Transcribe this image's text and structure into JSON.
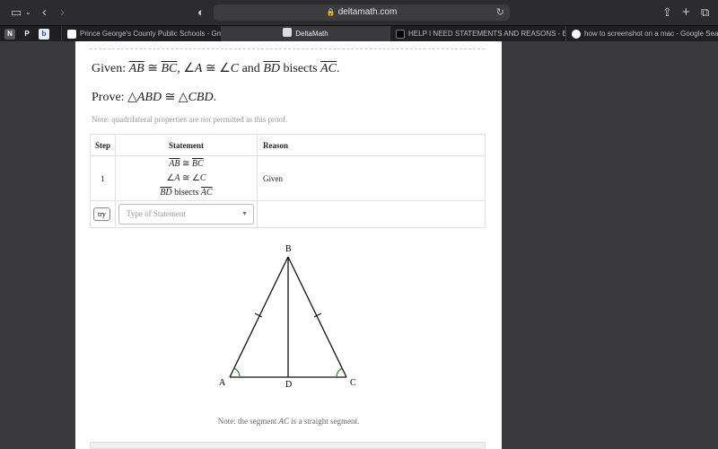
{
  "browser": {
    "url": "deltamath.com",
    "pinned": [
      "N",
      "P",
      "b"
    ],
    "tabs": [
      {
        "label": "Prince George's County Public Schools - Gmail Lo..."
      },
      {
        "label": "DeltaMath"
      },
      {
        "label": "HELP I NEED STATEMENTS AND REASONS - Brai..."
      },
      {
        "label": "how to screenshot on a mac - Google Search"
      }
    ]
  },
  "problem": {
    "given_label": "Given:",
    "ab": "AB",
    "bc": "BC",
    "angle_a": "A",
    "angle_c": "C",
    "and": "and",
    "bd": "BD",
    "bisects": "bisects",
    "ac": "AC",
    "prove_label": "Prove:",
    "tri1": "ABD",
    "tri2": "CBD",
    "note_pre": "Note: quadrilateral properties are ",
    "note_not": "not",
    "note_post": " permitted in this proof."
  },
  "table": {
    "headers": {
      "step": "Step",
      "statement": "Statement",
      "reason": "Reason"
    },
    "row1": {
      "step": "1",
      "reason": "Given"
    },
    "try_label": "try",
    "placeholder": "Type of Statement"
  },
  "diagram": {
    "labels": {
      "a": "A",
      "b": "B",
      "c": "C",
      "d": "D"
    }
  },
  "footer_note": {
    "pre": "Note: the segment ",
    "seg": "AC",
    "post": " is a straight segment."
  }
}
